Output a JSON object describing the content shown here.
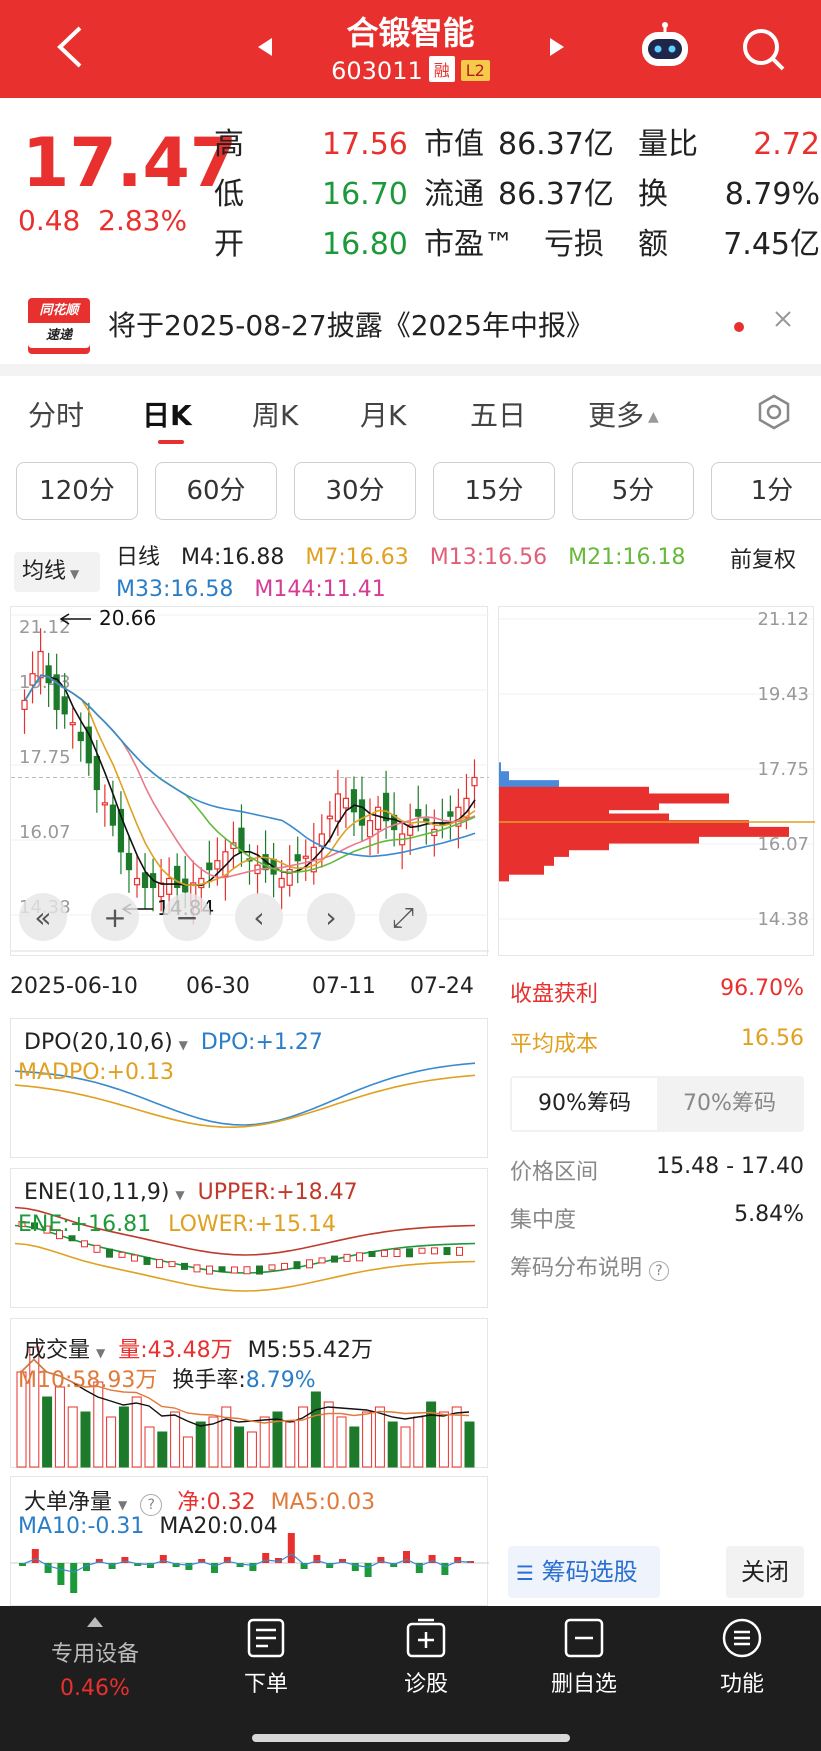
{
  "header": {
    "stock_name": "合锻智能",
    "stock_code": "603011",
    "tag_margin": "融",
    "tag_level": "L2"
  },
  "quote": {
    "price": "17.47",
    "change": "0.48",
    "change_pct": "2.83%",
    "rows": [
      {
        "label": "高",
        "value": "17.56",
        "label2": "市值",
        "value2": "86.37亿",
        "label3": "量比",
        "value3": "2.72"
      },
      {
        "label": "低",
        "value": "16.70",
        "label2": "流通",
        "value2": "86.37亿",
        "label3": "换",
        "value3": "8.79%"
      },
      {
        "label": "开",
        "value": "16.80",
        "label2": "市盈™",
        "value2": "亏损",
        "label3": "额",
        "value3": "7.45亿"
      }
    ]
  },
  "notice": {
    "logo_top": "同花顺",
    "logo_bottom": "速递",
    "text": "将于2025-08-27披露《2025年中报》"
  },
  "tabs": [
    "分时",
    "日K",
    "周K",
    "月K",
    "五日",
    "更多"
  ],
  "active_tab": 1,
  "periods": [
    "120分",
    "60分",
    "30分",
    "15分",
    "5分",
    "1分"
  ],
  "ma_bar": {
    "selector": "均线",
    "label": "日线",
    "m4": "M4:16.88",
    "m7": "M7:16.63",
    "m13": "M13:16.56",
    "m21": "M21:16.18",
    "m33": "M33:16.58",
    "m144": "M144:11.41",
    "adjust": "前复权"
  },
  "colors": {
    "up": "#e8302e",
    "down": "#1c7a2a",
    "m4": "#111111",
    "m7": "#e0a020",
    "m13": "#e87a8a",
    "m21": "#66b93a",
    "m33": "#3a8ad0"
  },
  "main_chart": {
    "y_ticks": [
      "21.12",
      "19.43",
      "17.75",
      "16.07",
      "14.38"
    ],
    "high_mark": "20.66",
    "low_mark": "14.84",
    "x_labels": [
      "2025-06-10",
      "06-30",
      "07-11",
      "07-24"
    ]
  },
  "chip": {
    "y_ticks": [
      "21.12",
      "19.43",
      "17.75",
      "16.07",
      "14.38"
    ],
    "profit_label": "收盘获利",
    "profit_value": "96.70%",
    "avg_cost_label": "平均成本",
    "avg_cost_value": "16.56",
    "tab_90": "90%筹码",
    "tab_70": "70%筹码",
    "range_label": "价格区间",
    "range_value": "15.48 - 17.40",
    "concentration_label": "集中度",
    "concentration_value": "5.84%",
    "help_text": "筹码分布说明",
    "select_button": "筹码选股",
    "close_button": "关闭"
  },
  "dpo": {
    "name": "DPO(20,10,6)",
    "dpo": "DPO:+1.27",
    "madpo": "MADPO:+0.13"
  },
  "ene": {
    "name": "ENE(10,11,9)",
    "upper": "UPPER:+18.47",
    "ene": "ENE:+16.81",
    "lower": "LOWER:+15.14"
  },
  "volume": {
    "name": "成交量",
    "vol": "量:43.48万",
    "m5": "M5:55.42万",
    "m10": "M10:58.93万",
    "turnover_label": "换手率:",
    "turnover": "8.79%"
  },
  "bigorder": {
    "name": "大单净量",
    "net": "净:0.32",
    "ma5": "MA5:0.03",
    "ma10": "MA10:-0.31",
    "ma20": "MA20:0.04"
  },
  "bottom_nav": {
    "sector": "专用设备",
    "sector_pct": "0.46%",
    "items": [
      "下单",
      "诊股",
      "删自选",
      "功能"
    ]
  }
}
